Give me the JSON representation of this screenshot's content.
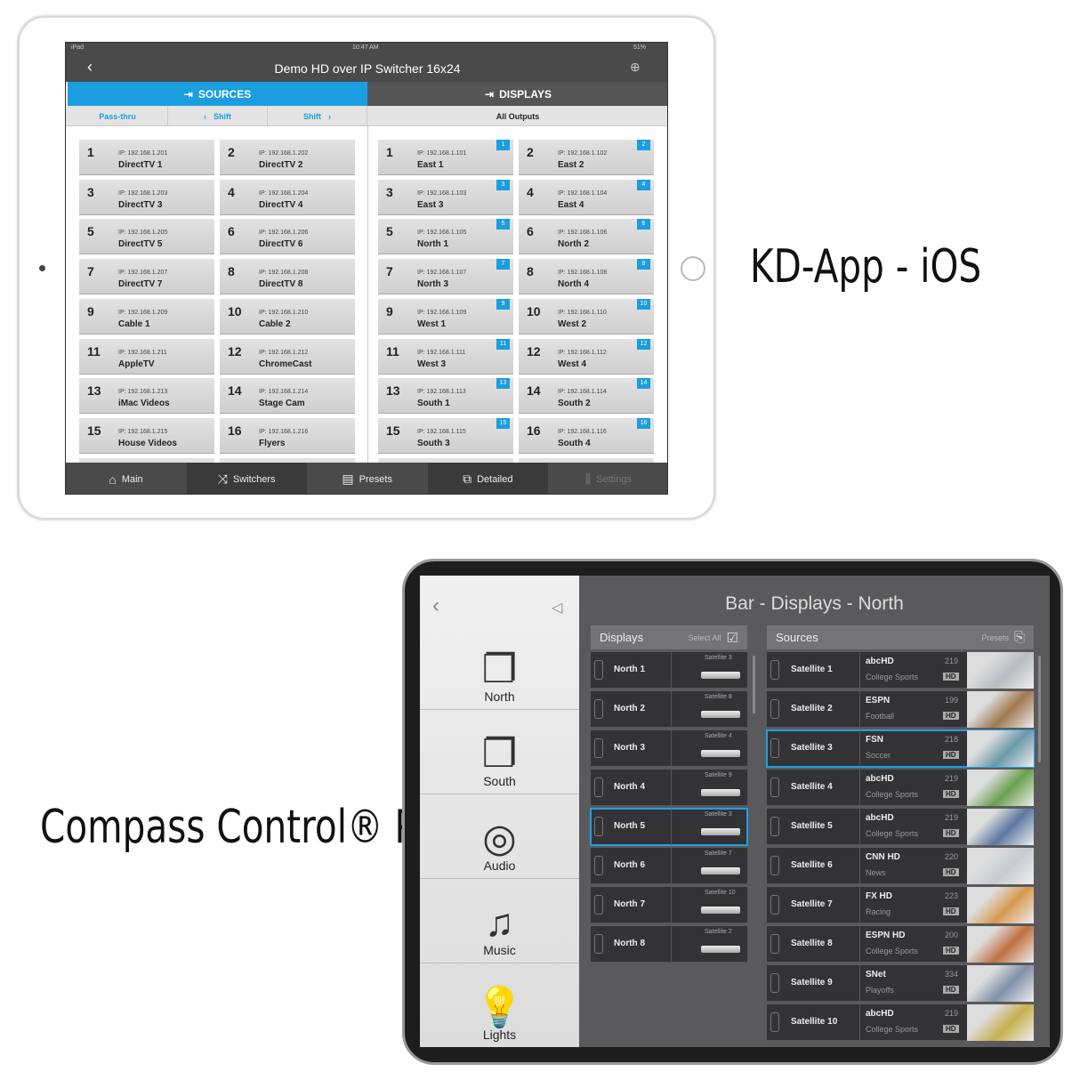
{
  "labels": {
    "kd": "KD-App - iOS",
    "compass": "Compass Control® Pro"
  },
  "kdapp": {
    "status": {
      "device": "iPad",
      "time": "10:47 AM",
      "battery": "51%"
    },
    "title": "Demo HD over IP Switcher 16x24",
    "tabs": {
      "sources": "SOURCES",
      "displays": "DISPLAYS"
    },
    "sub": {
      "passthru": "Pass-thru",
      "shift_left": "Shift",
      "shift_right": "Shift",
      "all_outputs": "All Outputs"
    },
    "accent": "#1a9ee0",
    "sources": [
      {
        "n": "1",
        "ip": "IP: 192.168.1.201",
        "name": "DirectTV 1"
      },
      {
        "n": "2",
        "ip": "IP: 192.168.1.202",
        "name": "DirectTV 2"
      },
      {
        "n": "3",
        "ip": "IP: 192.168.1.203",
        "name": "DirectTV 3"
      },
      {
        "n": "4",
        "ip": "IP: 192.168.1.204",
        "name": "DirectTV 4"
      },
      {
        "n": "5",
        "ip": "IP: 192.168.1.205",
        "name": "DirectTV 5"
      },
      {
        "n": "6",
        "ip": "IP: 192.168.1.206",
        "name": "DirectTV 6"
      },
      {
        "n": "7",
        "ip": "IP: 192.168.1.207",
        "name": "DirectTV 7"
      },
      {
        "n": "8",
        "ip": "IP: 192.168.1.208",
        "name": "DirectTV 8"
      },
      {
        "n": "9",
        "ip": "IP: 192.168.1.209",
        "name": "Cable 1"
      },
      {
        "n": "10",
        "ip": "IP: 192.168.1.210",
        "name": "Cable 2"
      },
      {
        "n": "11",
        "ip": "IP: 192.168.1.211",
        "name": "AppleTV"
      },
      {
        "n": "12",
        "ip": "IP: 192.168.1.212",
        "name": "ChromeCast"
      },
      {
        "n": "13",
        "ip": "IP: 192.168.1.213",
        "name": "iMac Videos"
      },
      {
        "n": "14",
        "ip": "IP: 192.168.1.214",
        "name": "Stage Cam"
      },
      {
        "n": "15",
        "ip": "IP: 192.168.1.215",
        "name": "House Videos"
      },
      {
        "n": "16",
        "ip": "IP: 192.168.1.216",
        "name": "Flyers"
      }
    ],
    "displays": [
      {
        "n": "1",
        "ip": "IP: 192.168.1.101",
        "name": "East 1",
        "badge": "1"
      },
      {
        "n": "2",
        "ip": "IP: 192.168.1.102",
        "name": "East 2",
        "badge": "2"
      },
      {
        "n": "3",
        "ip": "IP: 192.168.1.103",
        "name": "East 3",
        "badge": "3"
      },
      {
        "n": "4",
        "ip": "IP: 192.168.1.104",
        "name": "East 4",
        "badge": "4"
      },
      {
        "n": "5",
        "ip": "IP: 192.168.1.105",
        "name": "North 1",
        "badge": "5"
      },
      {
        "n": "6",
        "ip": "IP: 192.168.1.106",
        "name": "North 2",
        "badge": "6"
      },
      {
        "n": "7",
        "ip": "IP: 192.168.1.107",
        "name": "North 3",
        "badge": "7"
      },
      {
        "n": "8",
        "ip": "IP: 192.168.1.108",
        "name": "North 4",
        "badge": "8"
      },
      {
        "n": "9",
        "ip": "IP: 192.168.1.109",
        "name": "West 1",
        "badge": "9"
      },
      {
        "n": "10",
        "ip": "IP: 192.168.1.110",
        "name": "West 2",
        "badge": "10"
      },
      {
        "n": "11",
        "ip": "IP: 192.168.1.111",
        "name": "West 3",
        "badge": "11"
      },
      {
        "n": "12",
        "ip": "IP: 192.168.1.112",
        "name": "West 4",
        "badge": "12"
      },
      {
        "n": "13",
        "ip": "IP: 192.168.1.113",
        "name": "South 1",
        "badge": "13"
      },
      {
        "n": "14",
        "ip": "IP: 192.168.1.114",
        "name": "South 2",
        "badge": "14"
      },
      {
        "n": "15",
        "ip": "IP: 192.168.1.115",
        "name": "South 3",
        "badge": "15"
      },
      {
        "n": "16",
        "ip": "IP: 192.168.1.116",
        "name": "South 4",
        "badge": "16"
      }
    ],
    "bottom_tabs": [
      {
        "label": "Main",
        "icon": "home-icon"
      },
      {
        "label": "Switchers",
        "icon": "shuffle-icon",
        "active": true
      },
      {
        "label": "Presets",
        "icon": "presets-icon"
      },
      {
        "label": "Detailed",
        "icon": "detailed-icon",
        "active": true
      },
      {
        "label": "Settings",
        "icon": "settings-icon",
        "disabled": true
      }
    ]
  },
  "compass": {
    "title": "Bar - Displays - North",
    "side": [
      {
        "label": "North",
        "icon": "displays-icon"
      },
      {
        "label": "South",
        "icon": "displays-icon"
      },
      {
        "label": "Audio",
        "icon": "speaker-icon"
      },
      {
        "label": "Music",
        "icon": "music-note-icon"
      },
      {
        "label": "Lights",
        "icon": "lightbulb-icon"
      }
    ],
    "displays_header": "Displays",
    "select_all": "Select All",
    "sources_header": "Sources",
    "presets": "Presets",
    "accent": "#1ea0e6",
    "displays": [
      {
        "name": "North 1",
        "source": "Satellite 3"
      },
      {
        "name": "North 2",
        "source": "Satellite 8"
      },
      {
        "name": "North 3",
        "source": "Satellite 4"
      },
      {
        "name": "North 4",
        "source": "Satellite 9"
      },
      {
        "name": "North 5",
        "source": "Satellite 3",
        "selected": true
      },
      {
        "name": "North 6",
        "source": "Satellite 7"
      },
      {
        "name": "North 7",
        "source": "Satellite 10"
      },
      {
        "name": "North 8",
        "source": "Satellite 2"
      }
    ],
    "sources": [
      {
        "name": "Satellite 1",
        "channel": "abcHD",
        "program": "College Sports",
        "number": "219",
        "badge": "HD"
      },
      {
        "name": "Satellite 2",
        "channel": "ESPN",
        "program": "Football",
        "number": "199",
        "badge": "HD"
      },
      {
        "name": "Satellite 3",
        "channel": "FSN",
        "program": "Soccer",
        "number": "218",
        "badge": "HD",
        "selected": true
      },
      {
        "name": "Satellite 4",
        "channel": "abcHD",
        "program": "College Sports",
        "number": "219",
        "badge": "HD"
      },
      {
        "name": "Satellite 5",
        "channel": "abcHD",
        "program": "College Sports",
        "number": "219",
        "badge": "HD"
      },
      {
        "name": "Satellite 6",
        "channel": "CNN HD",
        "program": "News",
        "number": "220",
        "badge": "HD"
      },
      {
        "name": "Satellite 7",
        "channel": "FX HD",
        "program": "Racing",
        "number": "223",
        "badge": "HD"
      },
      {
        "name": "Satellite 8",
        "channel": "ESPN HD",
        "program": "College Sports",
        "number": "200",
        "badge": "HD"
      },
      {
        "name": "Satellite 9",
        "channel": "SNet",
        "program": "Playoffs",
        "number": "334",
        "badge": "HD"
      },
      {
        "name": "Satellite 10",
        "channel": "abcHD",
        "program": "College Sports",
        "number": "219",
        "badge": "HD"
      }
    ]
  }
}
